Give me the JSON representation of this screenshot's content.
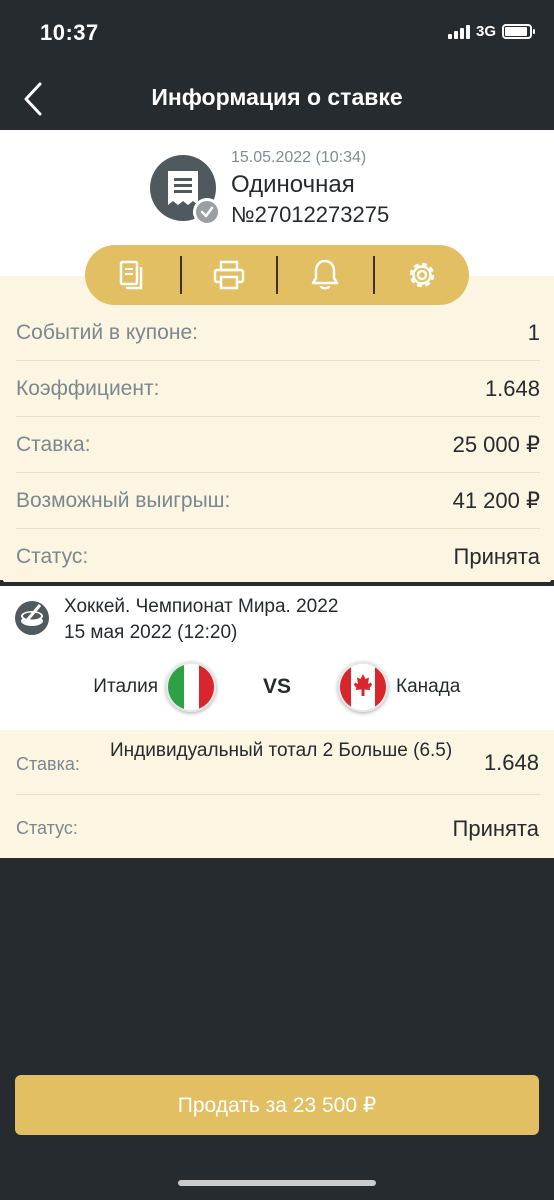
{
  "status_bar": {
    "time": "10:37",
    "network": "3G",
    "battery_percent": 90
  },
  "nav": {
    "title": "Информация о ставке",
    "back_icon": "chevron-left-icon"
  },
  "bet": {
    "date": "15.05.2022 (10:34)",
    "type": "Одиночная",
    "number": "№27012273275",
    "icon": "receipt-icon",
    "badge_icon": "check-icon"
  },
  "actions": [
    {
      "icon": "copy-icon"
    },
    {
      "icon": "print-icon"
    },
    {
      "icon": "bell-icon"
    },
    {
      "icon": "gear-icon"
    }
  ],
  "details": [
    {
      "label": "Событий в купоне:",
      "value": "1"
    },
    {
      "label": "Коэффициент:",
      "value": "1.648"
    },
    {
      "label": "Ставка:",
      "value": "25 000 ₽"
    },
    {
      "label": "Возможный выигрыш:",
      "value": "41 200 ₽"
    },
    {
      "label": "Статус:",
      "value": "Принята"
    }
  ],
  "event": {
    "sport_icon": "hockey-puck-icon",
    "title": "Хоккей. Чемпионат Мира. 2022",
    "date": "15 мая 2022 (12:20)",
    "team1": "Италия",
    "team2": "Канада",
    "vs": "VS"
  },
  "selection": {
    "stake_label": "Ставка:",
    "market": "Индивидуальный тотал 2 Больше (6.5)",
    "odds": "1.648",
    "status_label": "Статус:",
    "status_value": "Принята"
  },
  "sell_button": "Продать за 23 500 ₽",
  "colors": {
    "accent": "#e2bf62",
    "dark": "#262b2f",
    "cream": "#fbf5e1",
    "muted": "#7a8890"
  }
}
